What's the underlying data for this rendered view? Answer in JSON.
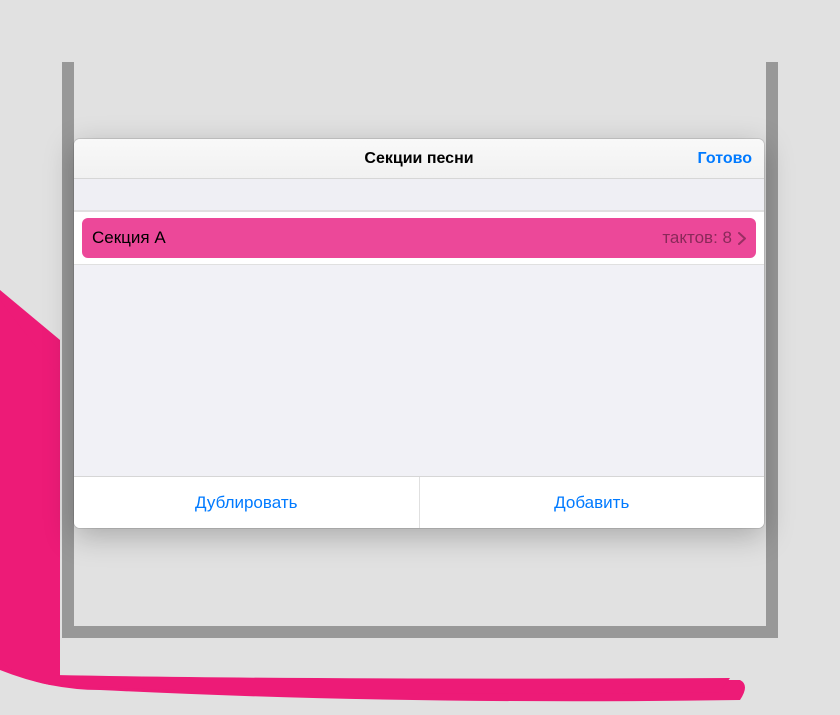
{
  "popover": {
    "title": "Секции песни",
    "done_label": "Готово"
  },
  "sections": [
    {
      "label": "Секция A",
      "detail": "тактов: 8"
    }
  ],
  "footer": {
    "duplicate_label": "Дублировать",
    "add_label": "Добавить"
  }
}
